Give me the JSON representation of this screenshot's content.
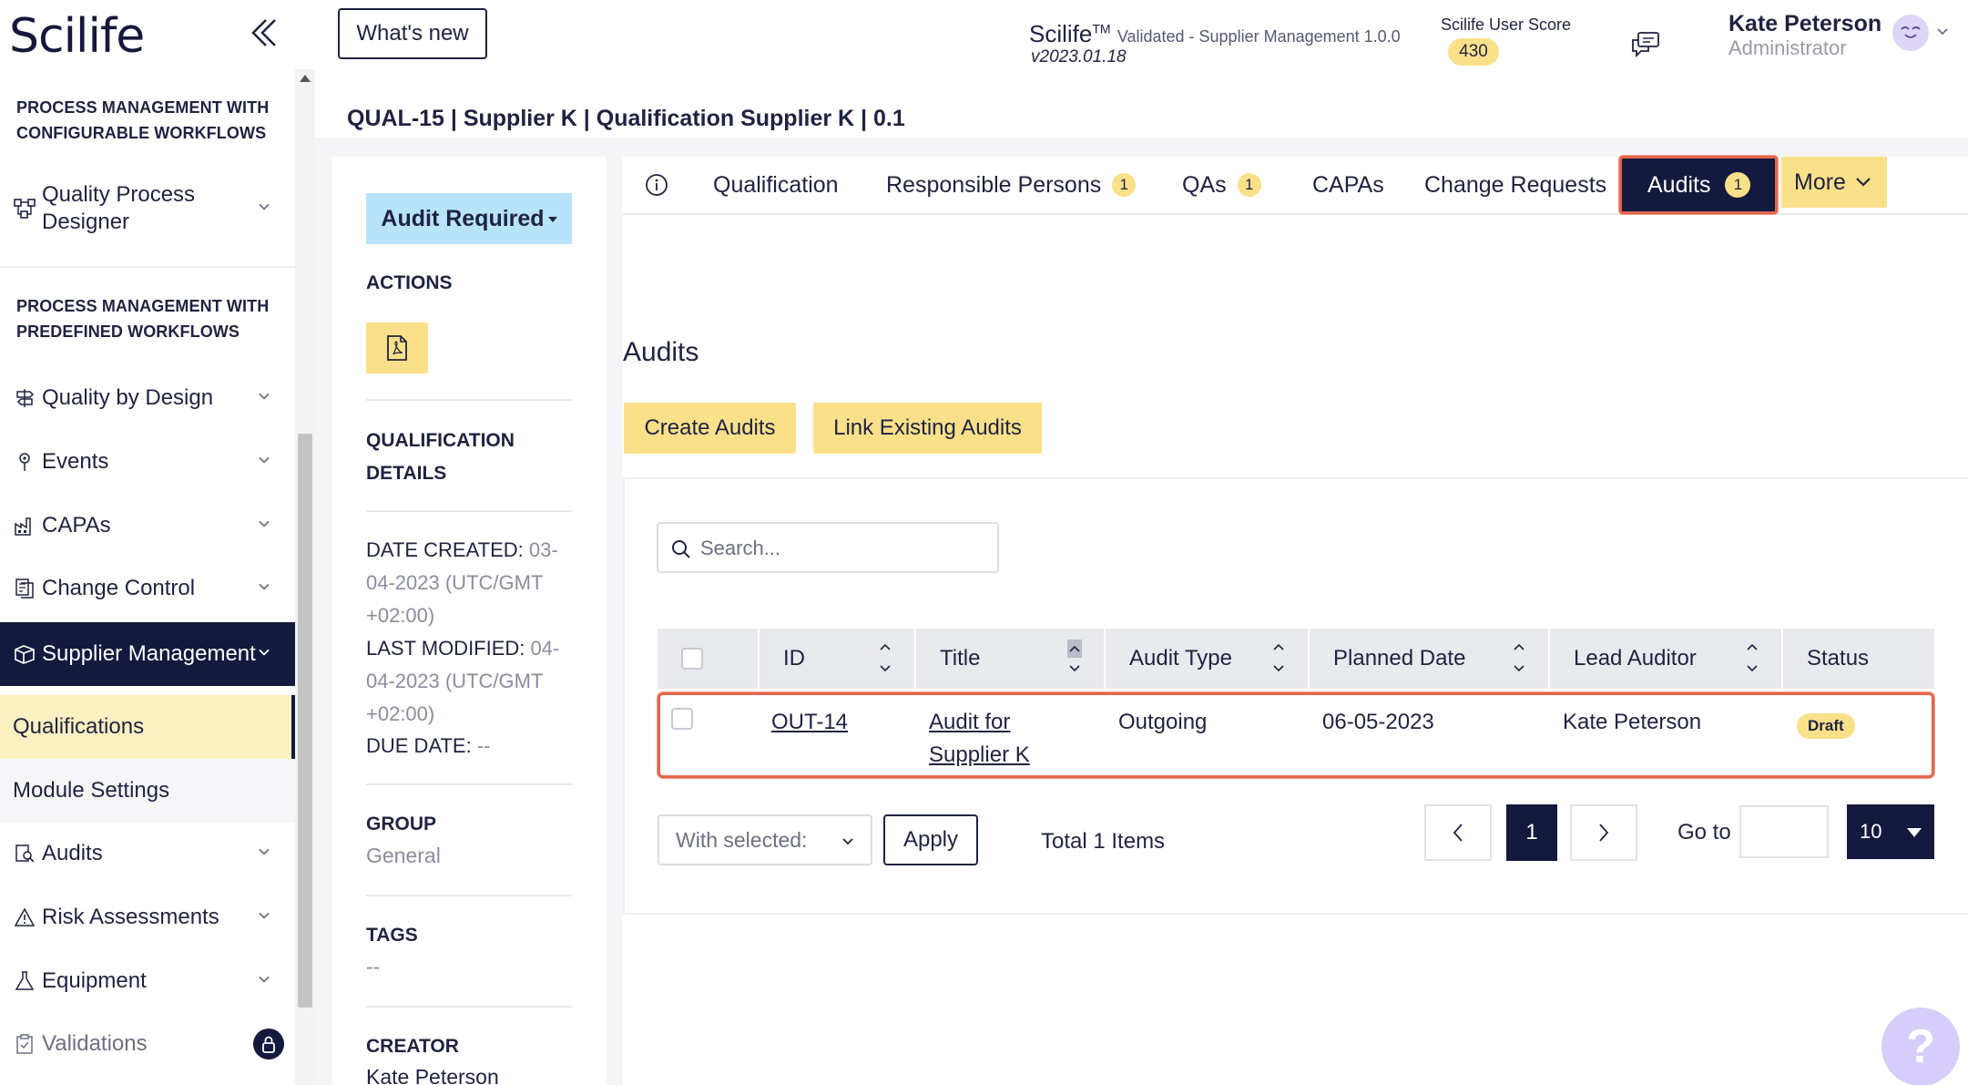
{
  "sidebar": {
    "logo": "Scilife",
    "section_configurable": "PROCESS MANAGEMENT WITH CONFIGURABLE WORKFLOWS",
    "section_predefined": "PROCESS MANAGEMENT WITH PREDEFINED WORKFLOWS",
    "quality_process_designer": "Quality Process Designer",
    "items": {
      "quality_by_design": "Quality by Design",
      "events": "Events",
      "capas": "CAPAs",
      "change_control": "Change Control",
      "supplier_management": "Supplier Management",
      "qualifications": "Qualifications",
      "module_settings": "Module Settings",
      "audits": "Audits",
      "risk_assessments": "Risk Assessments",
      "equipment": "Equipment",
      "validations": "Validations"
    }
  },
  "header": {
    "whats_new": "What's new",
    "app_name": "Scilife",
    "app_tm": "TM",
    "app_subtitle": "Validated - Supplier Management 1.0.0",
    "app_version": "v2023.01.18",
    "score_label": "Scilife User Score",
    "score_value": "430",
    "user_name": "Kate Peterson",
    "user_role": "Administrator"
  },
  "breadcrumb": "QUAL-15 | Supplier K | Qualification Supplier K | 0.1",
  "details": {
    "status": "Audit Required",
    "actions_label": "ACTIONS",
    "qualification_details_label": "QUALIFICATION DETAILS",
    "date_created_label": "DATE CREATED:",
    "date_created_value": "03-04-2023 (UTC/GMT +02:00)",
    "last_modified_label": "LAST MODIFIED:",
    "last_modified_value": "04-04-2023 (UTC/GMT +02:00)",
    "due_date_label": "DUE DATE:",
    "due_date_value": "--",
    "group_label": "GROUP",
    "group_value": "General",
    "tags_label": "TAGS",
    "tags_value": "--",
    "creator_label": "CREATOR",
    "creator_value": "Kate Peterson"
  },
  "tabs": {
    "qualification": "Qualification",
    "responsible_persons": "Responsible Persons",
    "responsible_persons_count": "1",
    "qas": "QAs",
    "qas_count": "1",
    "capas": "CAPAs",
    "change_requests": "Change Requests",
    "audits": "Audits",
    "audits_count": "1",
    "more": "More"
  },
  "audits": {
    "title": "Audits",
    "create_button": "Create Audits",
    "link_button": "Link Existing Audits",
    "search_placeholder": "Search...",
    "columns": {
      "id": "ID",
      "title": "Title",
      "audit_type": "Audit Type",
      "planned_date": "Planned Date",
      "lead_auditor": "Lead Auditor",
      "status": "Status"
    },
    "rows": [
      {
        "id": "OUT-14",
        "title_line1": "Audit for",
        "title_line2": "Supplier K",
        "audit_type": "Outgoing",
        "planned_date": "06-05-2023",
        "lead_auditor": "Kate Peterson",
        "status": "Draft"
      }
    ],
    "with_selected": "With selected:",
    "apply": "Apply",
    "total": "Total 1 Items",
    "current_page": "1",
    "goto_label": "Go to",
    "page_size": "10"
  },
  "help": "?",
  "colors": {
    "navy": "#141a3d",
    "yellow": "#fbe08a",
    "highlight": "#e4664b",
    "status_blue": "#b7e3fb"
  }
}
